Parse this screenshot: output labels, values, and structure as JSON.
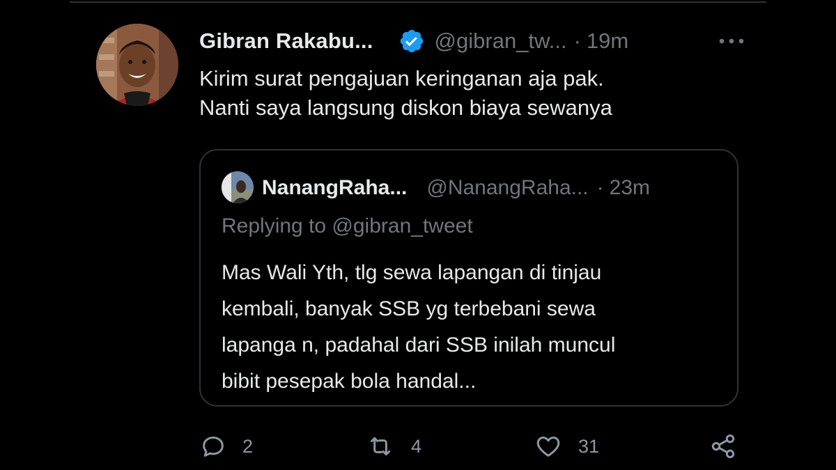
{
  "tweet": {
    "author_name": "Gibran Rakabu...",
    "handle": "@gibran_tw...",
    "separator": "·",
    "time": "19m",
    "text_lines": [
      "Kirim surat pengajuan keringanan aja pak.",
      "Nanti saya langsung diskon biaya sewanya"
    ]
  },
  "quoted_tweet": {
    "author_name": "NanangRaha...",
    "handle": "@NanangRaha...",
    "separator": "·",
    "time": "23m",
    "replying_to": "Replying to @gibran_tweet",
    "text_lines": [
      "Mas Wali Yth, tlg sewa lapangan di tinjau",
      "kembali, banyak SSB yg terbebani sewa",
      "lapanga n, padahal dari SSB inilah muncul",
      "bibit pesepak bola handal..."
    ]
  },
  "actions": {
    "reply_count": "2",
    "retweet_count": "4",
    "like_count": "31"
  },
  "icons": {
    "verified": "verified-badge-icon",
    "more": "more-options-icon",
    "reply": "reply-icon",
    "retweet": "retweet-icon",
    "like": "heart-icon",
    "share": "share-icon"
  },
  "colors": {
    "background": "#000000",
    "text_primary": "#e7e9ea",
    "text_secondary": "#71767b",
    "verified_blue": "#1d9bf0",
    "border": "#2f3336"
  }
}
